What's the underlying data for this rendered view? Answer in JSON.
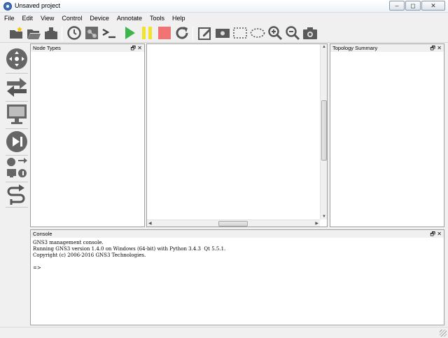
{
  "window": {
    "title": "Unsaved project"
  },
  "menu": [
    "File",
    "Edit",
    "View",
    "Control",
    "Device",
    "Annotate",
    "Tools",
    "Help"
  ],
  "toolbar": {
    "icons": [
      "new-project-icon",
      "open-project-icon",
      "save-project-icon",
      "snapshot-clock-icon",
      "show-interface-labels-icon",
      "console-all-icon",
      "start-all-icon",
      "suspend-all-icon",
      "stop-all-icon",
      "reload-all-icon",
      "add-note-icon",
      "insert-picture-icon",
      "draw-rectangle-icon",
      "draw-ellipse-icon",
      "zoom-in-icon",
      "zoom-out-icon",
      "screenshot-icon"
    ],
    "colors": {
      "start": "#3cb64a",
      "suspend": "#f2e32e",
      "stop": "#f07474"
    }
  },
  "devices": [
    "routers-icon",
    "switches-icon",
    "end-devices-icon",
    "security-devices-icon",
    "all-devices-icon",
    "add-link-icon"
  ],
  "panels": {
    "node_types": {
      "title": "Node Types"
    },
    "topology": {
      "title": "Topology Summary"
    },
    "console": {
      "title": "Console",
      "lines": [
        "GNS3 management console.",
        "Running GNS3 version 1.4.0 on Windows (64-bit) with Python 3.4.3  Qt 5.5.1.",
        "Copyright (c) 2006-2016 GNS3 Technologies.",
        "",
        "=>"
      ]
    },
    "controls": {
      "float": "🗗",
      "close": "✕"
    }
  },
  "window_controls": {
    "minimize": "‒",
    "maximize": "◻",
    "close": "✕"
  }
}
